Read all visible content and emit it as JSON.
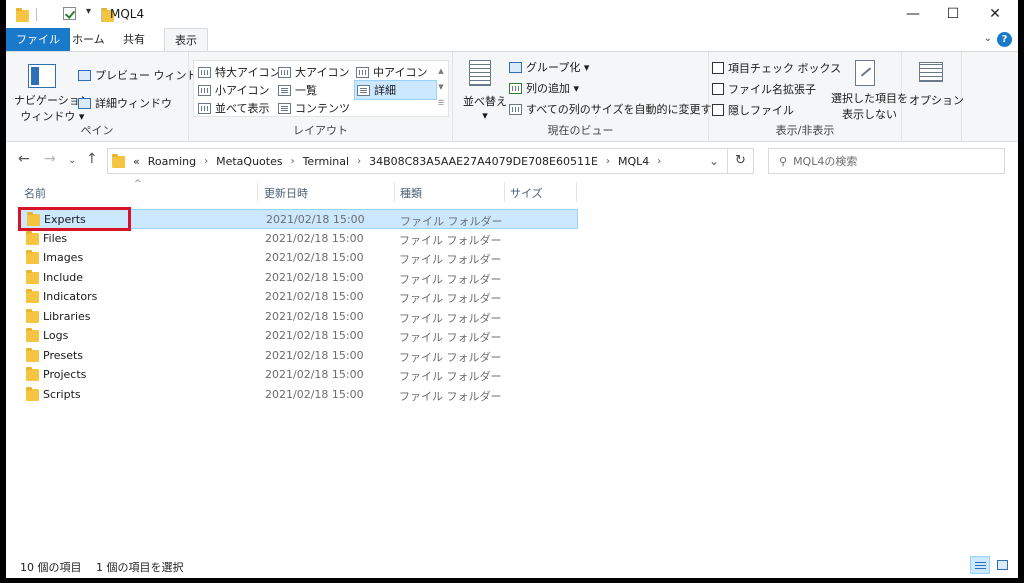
{
  "window": {
    "title": "MQL4",
    "controls": {
      "minimize": "—",
      "maximize": "☐",
      "close": "✕"
    }
  },
  "ribbon_tabs": [
    {
      "label": "ファイル"
    },
    {
      "label": "ホーム"
    },
    {
      "label": "共有"
    },
    {
      "label": "表示"
    }
  ],
  "ribbon": {
    "pane": {
      "nav_pane": [
        "ナビゲーション",
        "ウィンドウ ▾"
      ],
      "preview_pane": "プレビュー ウィンドウ",
      "details_pane": "詳細ウィンドウ",
      "label": "ペイン"
    },
    "layout": {
      "items": [
        "特大アイコン",
        "大アイコン",
        "中アイコン",
        "小アイコン",
        "一覧",
        "詳細",
        "並べて表示",
        "コンテンツ"
      ],
      "label": "レイアウト"
    },
    "current_view": {
      "sort": [
        "並べ替え",
        "▾"
      ],
      "group_by": "グループ化 ▾",
      "add_columns": "列の追加 ▾",
      "size_all_columns": "すべての列のサイズを自動的に変更する",
      "label": "現在のビュー"
    },
    "show_hide": {
      "item_checkboxes": "項目チェック ボックス",
      "file_extensions": "ファイル名拡張子",
      "hidden_items": "隠しファイル",
      "hide_selected": [
        "選択した項目を",
        "表示しない"
      ],
      "label": "表示/非表示"
    },
    "options": "オプション"
  },
  "address": {
    "overflow": "«",
    "crumbs": [
      "Roaming",
      "MetaQuotes",
      "Terminal",
      "34B08C83A5AAE27A4079DE708E60511E",
      "MQL4"
    ],
    "search_placeholder": "MQL4の検索"
  },
  "columns": [
    "名前",
    "更新日時",
    "種類",
    "サイズ"
  ],
  "files": [
    {
      "name": "Experts",
      "date": "2021/02/18 15:00",
      "type": "ファイル フォルダー",
      "selected": true
    },
    {
      "name": "Files",
      "date": "2021/02/18 15:00",
      "type": "ファイル フォルダー"
    },
    {
      "name": "Images",
      "date": "2021/02/18 15:00",
      "type": "ファイル フォルダー"
    },
    {
      "name": "Include",
      "date": "2021/02/18 15:00",
      "type": "ファイル フォルダー"
    },
    {
      "name": "Indicators",
      "date": "2021/02/18 15:00",
      "type": "ファイル フォルダー"
    },
    {
      "name": "Libraries",
      "date": "2021/02/18 15:00",
      "type": "ファイル フォルダー"
    },
    {
      "name": "Logs",
      "date": "2021/02/18 15:00",
      "type": "ファイル フォルダー"
    },
    {
      "name": "Presets",
      "date": "2021/02/18 15:00",
      "type": "ファイル フォルダー"
    },
    {
      "name": "Projects",
      "date": "2021/02/18 15:00",
      "type": "ファイル フォルダー"
    },
    {
      "name": "Scripts",
      "date": "2021/02/18 15:00",
      "type": "ファイル フォルダー"
    }
  ],
  "status": {
    "item_count": "10 個の項目",
    "selected_count": "1 個の項目を選択"
  },
  "colors": {
    "accent": "#1979ca",
    "selection": "#cce8ff",
    "highlight_box": "#d7132a",
    "folder": "#f5c542"
  }
}
